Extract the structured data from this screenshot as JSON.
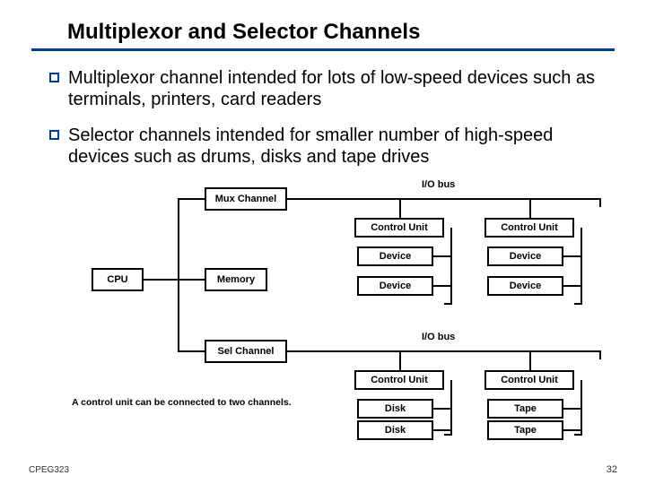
{
  "title": "Multiplexor and Selector Channels",
  "bullets": [
    "Multiplexor channel intended for lots of low-speed devices such as terminals, printers, card readers",
    "Selector channels intended for smaller number of high-speed devices such as drums, disks and tape drives"
  ],
  "diagram": {
    "cpu": "CPU",
    "memory": "Memory",
    "mux": "Mux Channel",
    "sel": "Sel Channel",
    "io_bus": "I/O bus",
    "cu": "Control Unit",
    "device": "Device",
    "disk": "Disk",
    "tape": "Tape",
    "note": "A control unit can be connected to two channels."
  },
  "footer": {
    "left": "CPEG323",
    "right": "32"
  }
}
